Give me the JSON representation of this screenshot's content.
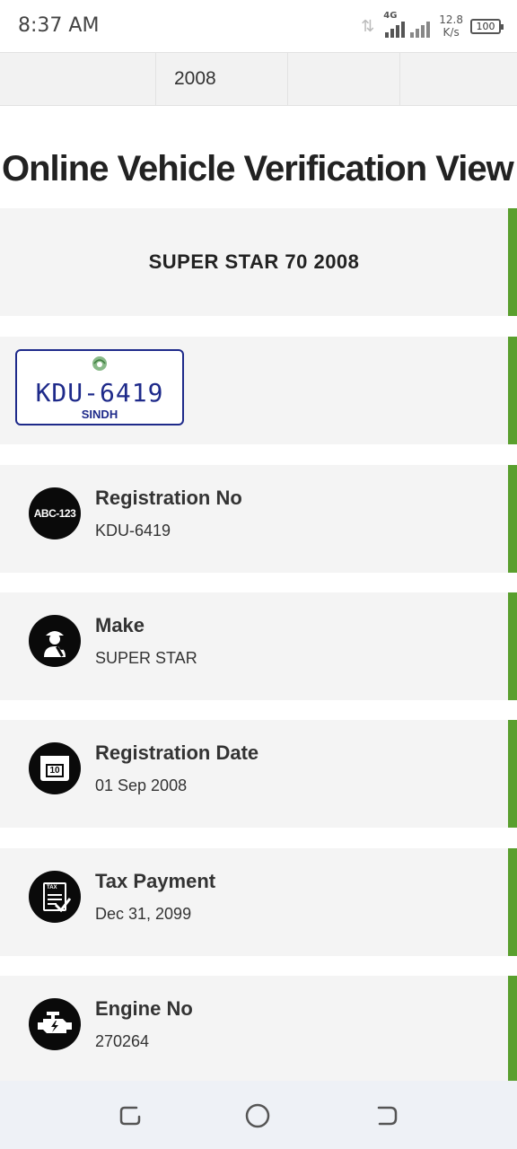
{
  "status_bar": {
    "time": "8:37 AM",
    "network_type": "4G",
    "speed_value": "12.8",
    "speed_unit": "K/s",
    "battery": "100"
  },
  "table": {
    "cells": [
      "",
      "2008",
      "",
      "",
      ""
    ]
  },
  "page": {
    "title": "Online Vehicle Verification View"
  },
  "summary": {
    "text": "SUPER STAR 70 2008"
  },
  "plate": {
    "number": "KDU-6419",
    "province": "SINDH"
  },
  "details": [
    {
      "label": "Registration No",
      "value": "KDU-6419",
      "icon": "registration-plate-icon",
      "icon_text": "ABC-123"
    },
    {
      "label": "Make",
      "value": "SUPER STAR",
      "icon": "mechanic-icon"
    },
    {
      "label": "Registration Date",
      "value": "01 Sep 2008",
      "icon": "calendar-icon",
      "icon_text": "10"
    },
    {
      "label": "Tax Payment",
      "value": "Dec 31, 2099",
      "icon": "tax-document-icon",
      "icon_text": "TAX"
    },
    {
      "label": "Engine No",
      "value": "270264",
      "icon": "engine-icon"
    }
  ],
  "colors": {
    "accent_bar": "#5a9f2e",
    "plate_blue": "#1e2a8a",
    "card_background": "#f4f4f4"
  },
  "navigation": {
    "buttons": [
      "recent-apps",
      "home",
      "back"
    ]
  }
}
